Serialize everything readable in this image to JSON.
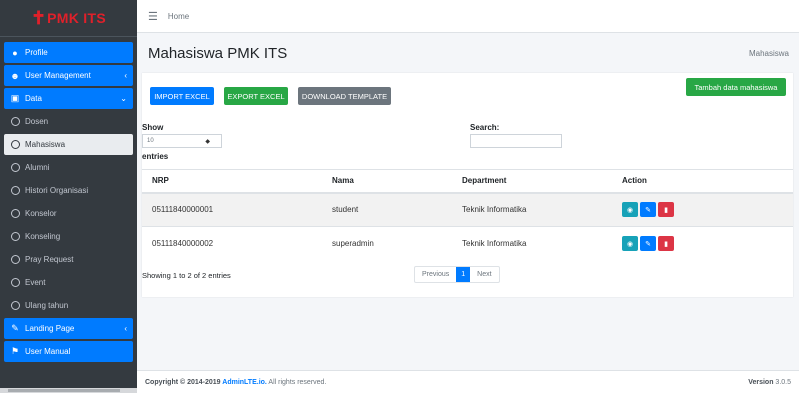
{
  "brand": {
    "symbol": "✝",
    "name": "PMK ITS"
  },
  "sidebar": {
    "items": [
      {
        "label": "Profile",
        "icon": "user-circle-icon"
      },
      {
        "label": "User Management",
        "icon": "users-icon"
      },
      {
        "label": "Data",
        "icon": "database-icon"
      },
      {
        "label": "Dosen"
      },
      {
        "label": "Mahasiswa"
      },
      {
        "label": "Alumni"
      },
      {
        "label": "Histori Organisasi"
      },
      {
        "label": "Konselor"
      },
      {
        "label": "Konseling"
      },
      {
        "label": "Pray Request"
      },
      {
        "label": "Event"
      },
      {
        "label": "Ulang tahun"
      },
      {
        "label": "Landing Page",
        "icon": "file-icon"
      },
      {
        "label": "User Manual",
        "icon": "manual-icon"
      }
    ]
  },
  "topbar": {
    "home": "Home"
  },
  "header": {
    "title": "Mahasiswa PMK ITS",
    "breadcrumb": "Mahasiswa"
  },
  "toolbar": {
    "import": "IMPORT EXCEL",
    "export": "EXPORT EXCEL",
    "template": "DOWNLOAD TEMPLATE",
    "add": "Tambah data mahasiswa"
  },
  "table_controls": {
    "show": "Show",
    "length_value": "10",
    "entries": "entries",
    "search": "Search:"
  },
  "table": {
    "columns": [
      "NRP",
      "Nama",
      "Department",
      "Action"
    ],
    "rows": [
      {
        "nrp": "05111840000001",
        "nama": "student",
        "department": "Teknik Informatika"
      },
      {
        "nrp": "05111840000002",
        "nama": "superadmin",
        "department": "Teknik Informatika"
      }
    ]
  },
  "pagination": {
    "info": "Showing 1 to 2 of 2 entries",
    "previous": "Previous",
    "page": "1",
    "next": "Next"
  },
  "footer": {
    "copyright": "Copyright © 2014-2019 ",
    "brand": "AdminLTE.io.",
    "rights": " All rights reserved.",
    "version_label": "Version",
    "version": " 3.0.5"
  },
  "colors": {
    "primary": "#007bff",
    "success": "#28a745",
    "secondary": "#6c757d",
    "info": "#17a2b8",
    "danger": "#dc3545",
    "sidebar": "#343a40",
    "brand": "#e0202a"
  }
}
